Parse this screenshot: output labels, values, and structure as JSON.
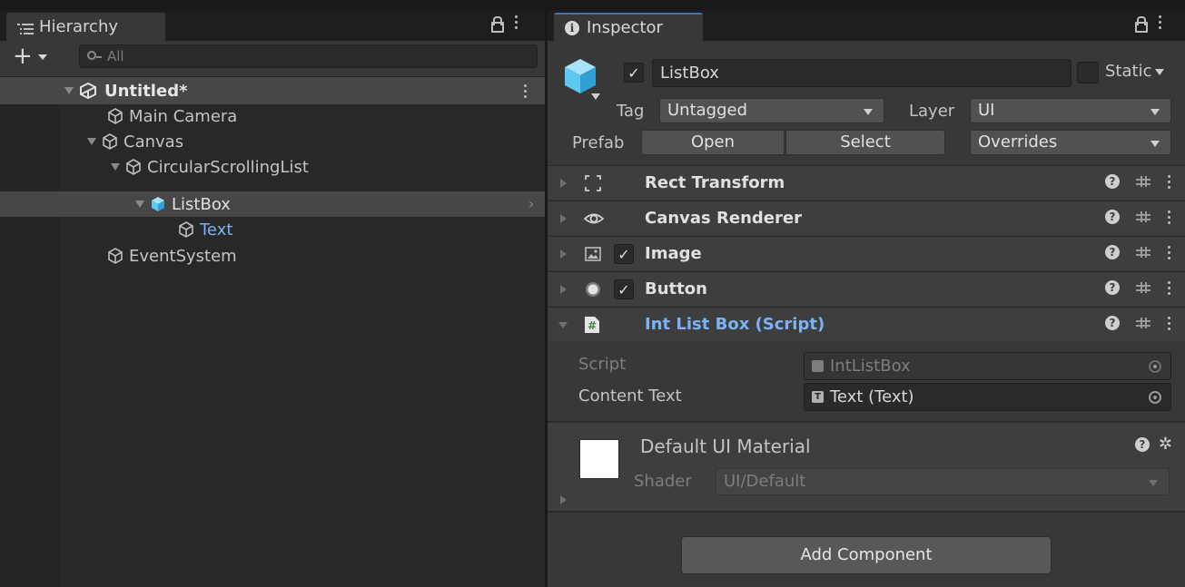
{
  "hierarchy": {
    "tab_label": "Hierarchy",
    "search_placeholder": "All",
    "add_label": "+",
    "scene_name": "Untitled*",
    "items": [
      {
        "label": "Main Camera"
      },
      {
        "label": "Canvas"
      },
      {
        "label": "CircularScrollingList"
      },
      {
        "label": "ListBox"
      },
      {
        "label": "Text"
      },
      {
        "label": "EventSystem"
      }
    ]
  },
  "inspector": {
    "tab_label": "Inspector",
    "object_name": "ListBox",
    "static_label": "Static",
    "tag_label": "Tag",
    "tag_value": "Untagged",
    "layer_label": "Layer",
    "layer_value": "UI",
    "prefab_label": "Prefab",
    "prefab_open": "Open",
    "prefab_select": "Select",
    "prefab_overrides": "Overrides",
    "components": [
      {
        "title": "Rect Transform"
      },
      {
        "title": "Canvas Renderer"
      },
      {
        "title": "Image"
      },
      {
        "title": "Button"
      },
      {
        "title": "Int List Box (Script)"
      }
    ],
    "script_label": "Script",
    "script_value": "IntListBox",
    "content_text_label": "Content Text",
    "content_text_value": "Text (Text)",
    "material_name": "Default UI Material",
    "shader_label": "Shader",
    "shader_value": "UI/Default",
    "add_component_label": "Add Component"
  },
  "colors": {
    "accent_blue": "#7cb2f5",
    "selection": "#474747",
    "cube_blue": "#5ec8f2"
  }
}
